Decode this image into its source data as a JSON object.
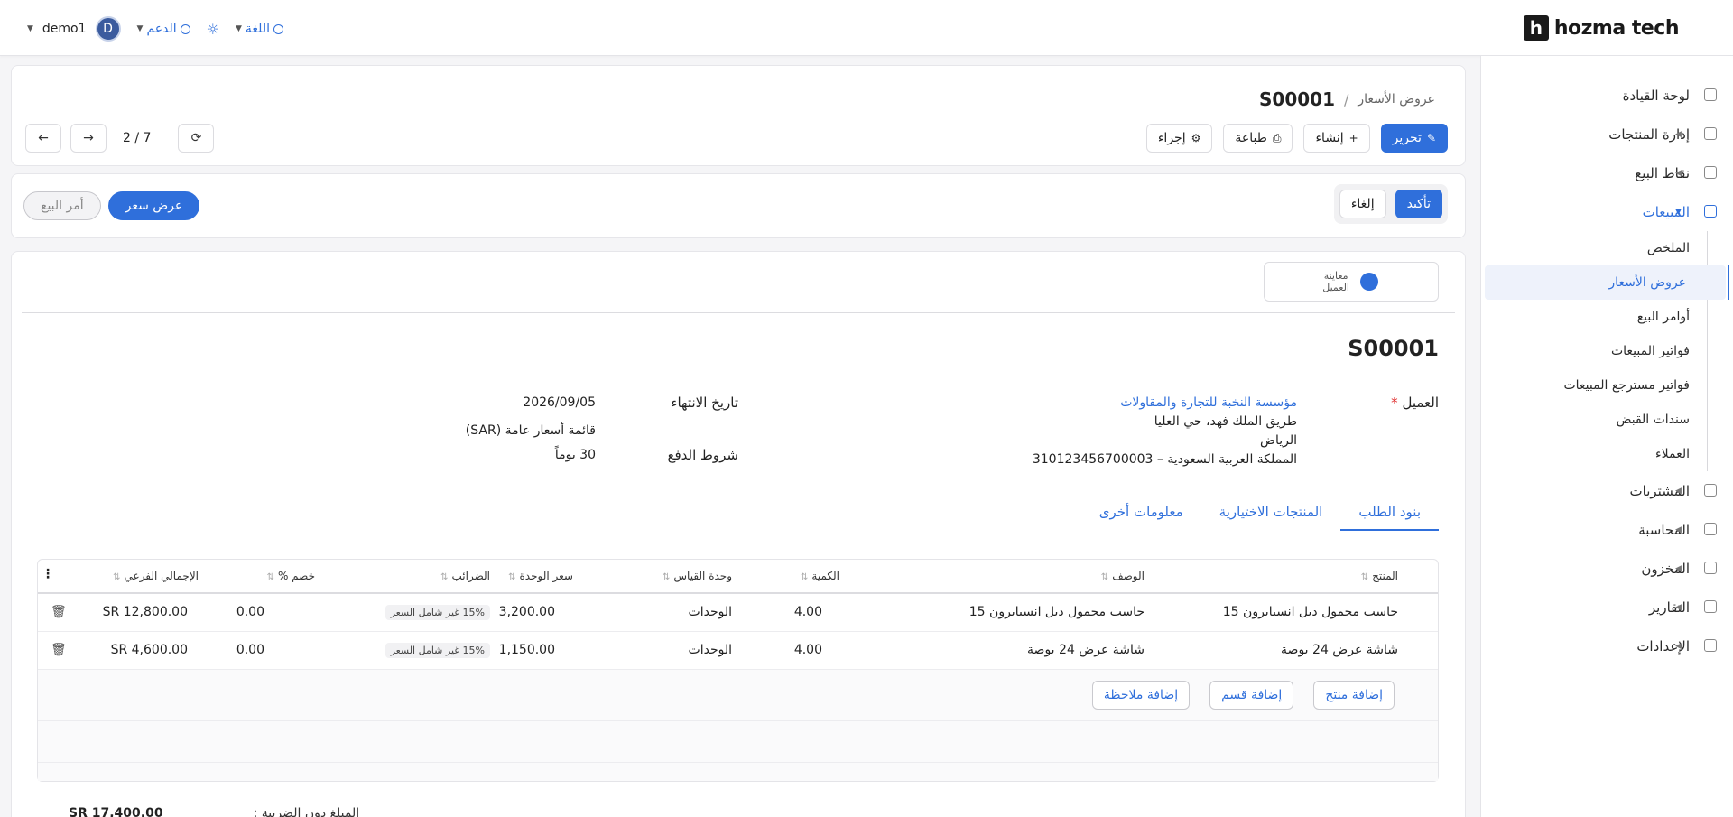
{
  "topbar": {
    "brand": "hozma tech",
    "brand_mark": "h",
    "user": "demo1",
    "avatar_letter": "D",
    "support": "الدعم",
    "language": "اللغة"
  },
  "sidebar": {
    "items": [
      {
        "label": "لوحة القيادة",
        "icon": "dashboard-icon",
        "arrow": ""
      },
      {
        "label": "إدارة المنتجات",
        "icon": "tag-icon",
        "arrow": "◀"
      },
      {
        "label": "نقاط البيع",
        "icon": "store-icon",
        "arrow": "◀"
      },
      {
        "label": "المبيعات",
        "icon": "chart-icon",
        "arrow": "▼"
      }
    ],
    "sales_sub": [
      "الملخص",
      "عروض الأسعار",
      "أوامر البيع",
      "فواتير المبيعات",
      "فواتير مسترجع المبيعات",
      "سندات القبض",
      "العملاء"
    ],
    "items_after": [
      {
        "label": "المشتريات",
        "icon": "purchases-icon",
        "arrow": "◀"
      },
      {
        "label": "المحاسبة",
        "icon": "accounting-icon",
        "arrow": "◀"
      },
      {
        "label": "المخزون",
        "icon": "inventory-icon",
        "arrow": "◀"
      },
      {
        "label": "التقارير",
        "icon": "reports-icon",
        "arrow": "◀"
      },
      {
        "label": "الإعدادات",
        "icon": "settings-icon",
        "arrow": "◀"
      }
    ]
  },
  "breadcrumb": {
    "parent": "عروض الأسعار",
    "sep": "/",
    "current": "S00001"
  },
  "toolbar": {
    "edit": "تحرير",
    "create": "إنشاء",
    "print": "طباعة",
    "action": "إجراء",
    "pager": "2 / 7"
  },
  "state": {
    "confirm": "تأكيد",
    "cancel": "إلغاء",
    "quotation": "عرض سعر",
    "sale_order": "أمر البيع"
  },
  "preview": {
    "line1": "معاينة",
    "line2": "العميل"
  },
  "doc": {
    "title": "S00001",
    "customer_label": "العميل",
    "customer_name": "مؤسسة النخبة للتجارة والمقاولات",
    "address1": "طريق الملك فهد، حي العليا",
    "address2": "الرياض",
    "address3": "المملكة العربية السعودية – 310123456700003",
    "expiry_label": "تاريخ الانتهاء",
    "expiry_value": "2026/09/05",
    "pricelist_value": "قائمة أسعار عامة (SAR)",
    "payment_label": "شروط الدفع",
    "payment_value": "30 يوماً"
  },
  "tabs": [
    "بنود الطلب",
    "المنتجات الاختيارية",
    "معلومات أخرى"
  ],
  "table": {
    "headers": {
      "product": "المنتج",
      "desc": "الوصف",
      "qty": "الكمية",
      "uom": "وحدة القياس",
      "price": "سعر الوحدة",
      "taxes": "الضرائب",
      "disc": "خصم %",
      "subtotal": "الإجمالي الفرعي"
    },
    "rows": [
      {
        "product": "حاسب محمول ديل انسبايرون 15",
        "desc": "حاسب محمول ديل انسبايرون 15",
        "qty": "4.00",
        "uom": "الوحدات",
        "price": "3,200.00",
        "tax": "15% غير شامل السعر",
        "disc": "0.00",
        "subtotal": "SR 12,800.00"
      },
      {
        "product": "شاشة عرض 24 بوصة",
        "desc": "شاشة عرض 24 بوصة",
        "qty": "4.00",
        "uom": "الوحدات",
        "price": "1,150.00",
        "tax": "15% غير شامل السعر",
        "disc": "0.00",
        "subtotal": "SR 4,600.00"
      }
    ],
    "add_product": "إضافة منتج",
    "add_section": "إضافة قسم",
    "add_note": "إضافة ملاحظة"
  },
  "totals": {
    "untaxed_label": "المبلغ دون الضريبة :",
    "untaxed_value": "SR 17,400.00"
  },
  "colors": {
    "accent": "#2f6fdb",
    "sidebar_active_bg": "#eef2fb"
  }
}
